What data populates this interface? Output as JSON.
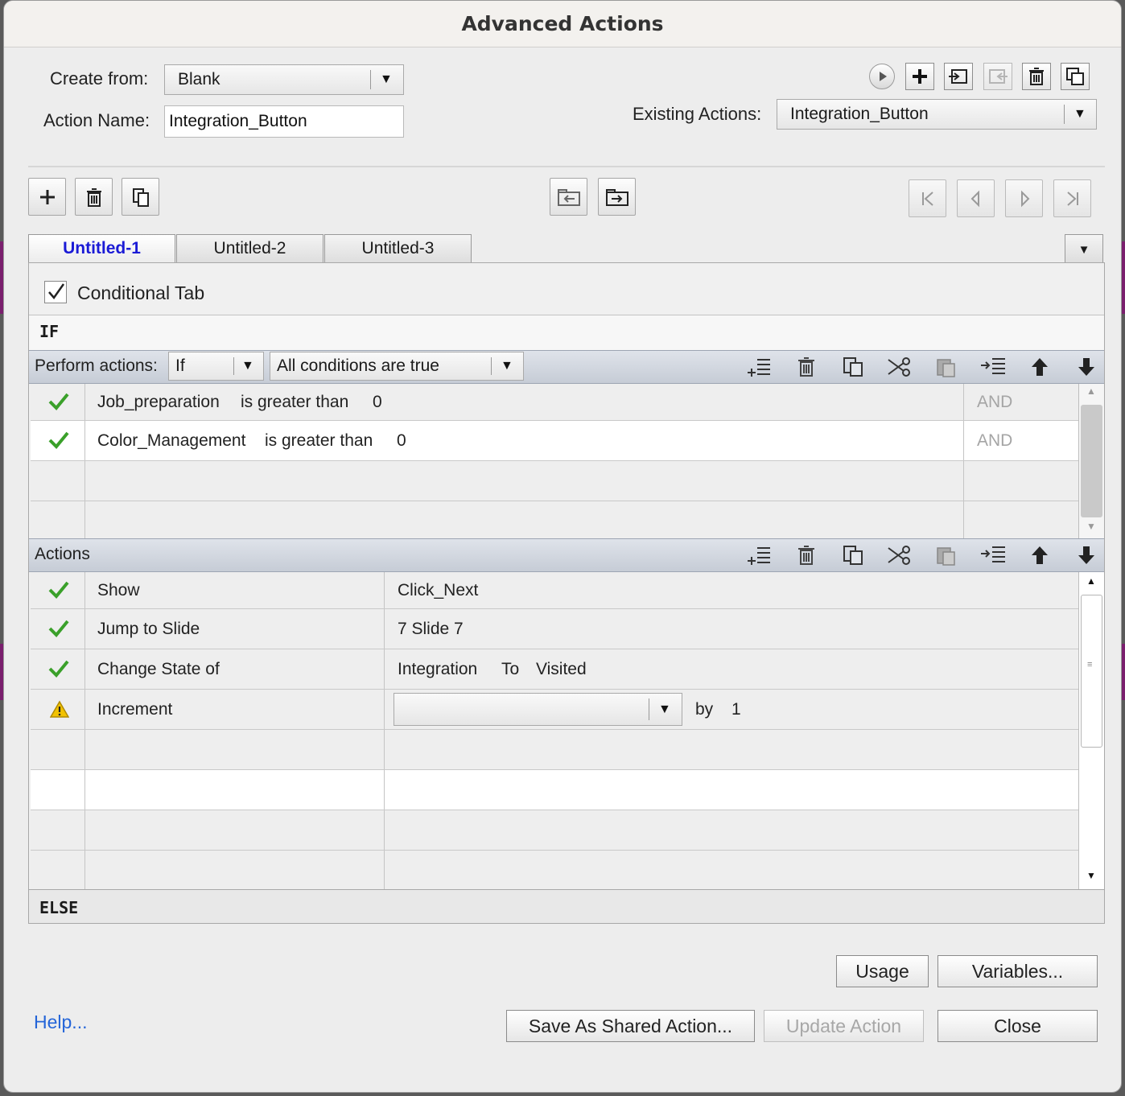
{
  "window": {
    "title": "Advanced Actions"
  },
  "form": {
    "create_from_label": "Create from:",
    "create_from_value": "Blank",
    "action_name_label": "Action Name:",
    "action_name_value": "Integration_Button",
    "existing_actions_label": "Existing Actions:",
    "existing_actions_value": "Integration_Button"
  },
  "tabs": [
    {
      "label": "Untitled-1",
      "active": true
    },
    {
      "label": "Untitled-2",
      "active": false
    },
    {
      "label": "Untitled-3",
      "active": false
    }
  ],
  "conditional_tab": {
    "label": "Conditional Tab",
    "checked": true
  },
  "if_section": {
    "label": "IF",
    "perform_actions_label": "Perform actions:",
    "perform_mode": "If",
    "condition_mode": "All conditions are true",
    "conditions": [
      {
        "status": "ok",
        "variable": "Job_preparation",
        "operator": "is greater than",
        "value": "0",
        "join": "AND"
      },
      {
        "status": "ok",
        "variable": "Color_Management",
        "operator": "is greater than",
        "value": "0",
        "join": "AND"
      }
    ]
  },
  "actions_section": {
    "label": "Actions",
    "rows": [
      {
        "status": "ok",
        "action": "Show",
        "target": "Click_Next"
      },
      {
        "status": "ok",
        "action": "Jump to Slide",
        "target": "7 Slide 7"
      },
      {
        "status": "ok",
        "action": "Change State of",
        "target": "Integration",
        "to_label": "To",
        "state": "Visited"
      },
      {
        "status": "warning",
        "action": "Increment",
        "dropdown_value": "",
        "by_label": "by",
        "by_value": "1"
      }
    ]
  },
  "else_section": {
    "label": "ELSE"
  },
  "buttons": {
    "usage": "Usage",
    "variables": "Variables...",
    "help": "Help...",
    "save_shared": "Save As Shared Action...",
    "update": "Update Action",
    "close": "Close"
  },
  "colors": {
    "active_tab": "#1b1bd6",
    "check": "#3aa02a",
    "warning": "#f2c200",
    "link": "#2465d8"
  }
}
